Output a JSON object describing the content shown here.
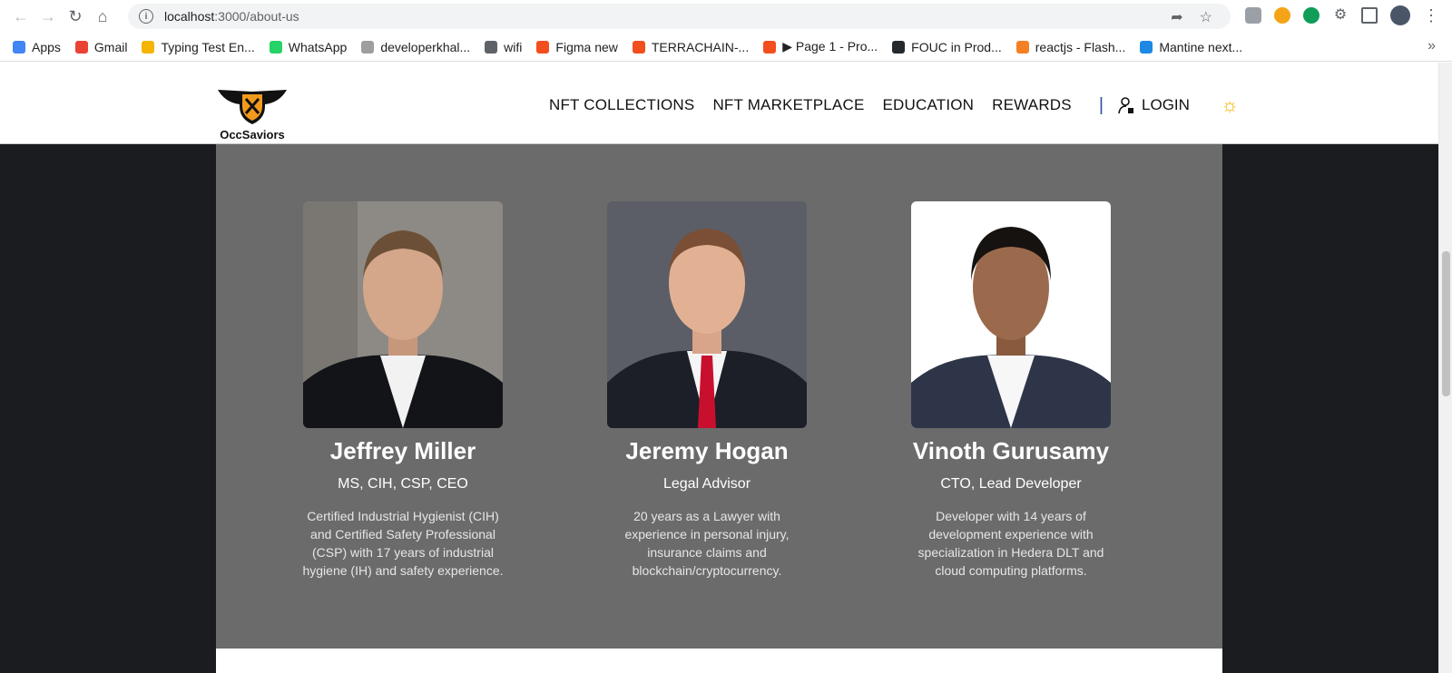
{
  "browser": {
    "url_host": "localhost",
    "url_path": ":3000/about-us"
  },
  "bookmarks": [
    {
      "label": "Apps",
      "color": "#4285f4"
    },
    {
      "label": "Gmail",
      "color": "#ea4335"
    },
    {
      "label": "Typing Test En...",
      "color": "#f4b400"
    },
    {
      "label": "WhatsApp",
      "color": "#25d366"
    },
    {
      "label": "developerkhal...",
      "color": "#9e9e9e"
    },
    {
      "label": "wifi",
      "color": "#5f6368"
    },
    {
      "label": "Figma new",
      "color": "#f24e1e"
    },
    {
      "label": "TERRACHAIN-...",
      "color": "#f24e1e"
    },
    {
      "label": "▶ Page 1 - Pro...",
      "color": "#f24e1e"
    },
    {
      "label": "FOUC in Prod...",
      "color": "#24292e"
    },
    {
      "label": "reactjs - Flash...",
      "color": "#f48024"
    },
    {
      "label": "Mantine next...",
      "color": "#1e88e5"
    }
  ],
  "site": {
    "logo_text": "OccSaviors",
    "nav": [
      "NFT COLLECTIONS",
      "NFT MARKETPLACE",
      "EDUCATION",
      "REWARDS"
    ],
    "separator": "|",
    "login": "LOGIN"
  },
  "team": [
    {
      "name": "Jeffrey Miller",
      "role": "MS, CIH, CSP, CEO",
      "bio": "Certified Industrial Hygienist (CIH) and Certified Safety Professional (CSP) with 17 years of industrial hygiene (IH) and safety experience."
    },
    {
      "name": "Jeremy Hogan",
      "role": "Legal Advisor",
      "bio": "20 years as a Lawyer with experience in personal injury, insurance claims and blockchain/cryptocurrency."
    },
    {
      "name": "Vinoth Gurusamy",
      "role": "CTO, Lead Developer",
      "bio": "Developer with 14 years of development experience with specialization in Hedera DLT and cloud computing platforms."
    }
  ]
}
